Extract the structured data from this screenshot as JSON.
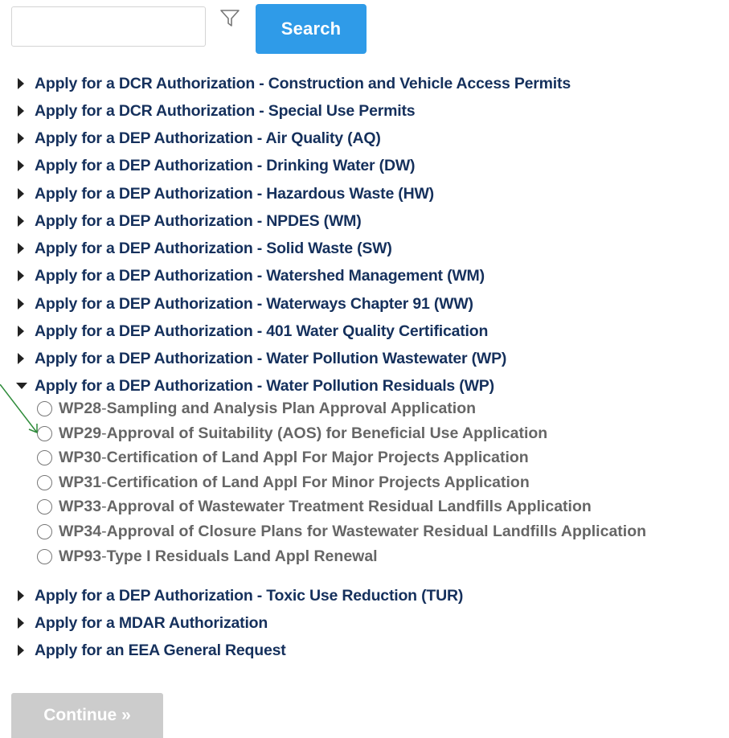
{
  "search": {
    "input_value": "",
    "placeholder": "",
    "button_label": "Search",
    "filter_icon": "filter-funnel-icon"
  },
  "categories_before": [
    {
      "label": "Apply for a DCR Authorization - Construction and Vehicle Access Permits",
      "expanded": false
    },
    {
      "label": "Apply for a DCR Authorization - Special Use Permits",
      "expanded": false
    },
    {
      "label": "Apply for a DEP Authorization - Air Quality (AQ)",
      "expanded": false
    },
    {
      "label": "Apply for a DEP Authorization - Drinking Water (DW)",
      "expanded": false
    },
    {
      "label": "Apply for a DEP Authorization - Hazardous Waste (HW)",
      "expanded": false
    },
    {
      "label": "Apply for a DEP Authorization - NPDES (WM)",
      "expanded": false
    },
    {
      "label": "Apply for a DEP Authorization - Solid Waste (SW)",
      "expanded": false
    },
    {
      "label": "Apply for a DEP Authorization - Watershed Management (WM)",
      "expanded": false
    },
    {
      "label": "Apply for a DEP Authorization - Waterways Chapter 91 (WW)",
      "expanded": false
    },
    {
      "label": "Apply for a DEP Authorization - 401 Water Quality Certification",
      "expanded": false
    },
    {
      "label": "Apply for a DEP Authorization - Water Pollution Wastewater (WP)",
      "expanded": false
    }
  ],
  "expanded_category": {
    "label": "Apply for a DEP Authorization - Water Pollution Residuals (WP)",
    "expanded": true,
    "options": [
      {
        "code": "WP28",
        "separator": " - ",
        "desc": "Sampling and Analysis Plan Approval Application",
        "selected": false
      },
      {
        "code": "WP29",
        "separator": " - ",
        "desc": "Approval of Suitability (AOS) for Beneficial Use Application",
        "selected": false
      },
      {
        "code": "WP30",
        "separator": " - ",
        "desc": "Certification of Land Appl For Major Projects Application",
        "selected": false
      },
      {
        "code": "WP31",
        "separator": " - ",
        "desc": "Certification of Land Appl For Minor Projects Application",
        "selected": false
      },
      {
        "code": "WP33",
        "separator": " - ",
        "desc": "Approval of Wastewater Treatment Residual Landfills Application",
        "selected": false
      },
      {
        "code": "WP34",
        "separator": " - ",
        "desc": "Approval of Closure Plans for Wastewater Residual Landfills Application",
        "selected": false
      },
      {
        "code": "WP93",
        "separator": " - ",
        "desc": "Type I Residuals Land Appl Renewal",
        "selected": false
      }
    ]
  },
  "categories_after": [
    {
      "label": "Apply for a DEP Authorization - Toxic Use Reduction (TUR)",
      "expanded": false
    },
    {
      "label": "Apply for a MDAR Authorization",
      "expanded": false
    },
    {
      "label": "Apply for an EEA General Request",
      "expanded": false
    }
  ],
  "continue_button": {
    "label": "Continue »",
    "enabled": false
  },
  "colors": {
    "category_text": "#15305c",
    "option_text": "#666666",
    "search_button": "#2f9be8",
    "continue_button": "#cccccc",
    "annotation_arrow": "#2e8b3a"
  }
}
